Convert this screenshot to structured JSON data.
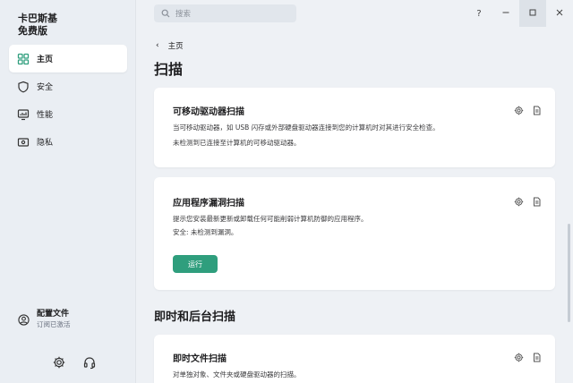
{
  "app": {
    "name_line1": "卡巴斯基",
    "name_line2": "免费版"
  },
  "sidebar": {
    "items": [
      {
        "label": "主页",
        "icon": "home-icon",
        "active": true
      },
      {
        "label": "安全",
        "icon": "shield-icon",
        "active": false
      },
      {
        "label": "性能",
        "icon": "performance-icon",
        "active": false
      },
      {
        "label": "隐私",
        "icon": "privacy-icon",
        "active": false
      }
    ],
    "profile": {
      "title": "配置文件",
      "subtitle": "订阅已激活",
      "icon": "user-icon"
    },
    "bottom_icons": [
      "gear-icon",
      "headset-icon"
    ]
  },
  "header": {
    "search_placeholder": "搜索",
    "help": "?",
    "controls": [
      "minimize-icon",
      "maximize-icon",
      "close-icon"
    ]
  },
  "breadcrumb": {
    "label": "主页"
  },
  "page_title": "扫描",
  "cards": [
    {
      "title": "可移动驱动器扫描",
      "lines": [
        "当可移动驱动器，如 USB 闪存或外部硬盘驱动器连接到您的计算机时对其进行安全检查。",
        "未检测到已连接至计算机的可移动驱动器。"
      ]
    },
    {
      "title": "应用程序漏洞扫描",
      "lines": [
        "提示您安装最新更新或卸载任何可能削弱计算机防御的应用程序。",
        "安全: 未检测到漏洞。"
      ],
      "button": "运行"
    },
    {
      "title": "即时文件扫描",
      "lines": [
        "对单独对象、文件夹或硬盘驱动器的扫描。"
      ]
    }
  ],
  "section_title": "即时和后台扫描",
  "colors": {
    "accent": "#2f9e7d",
    "sidebar_bg": "#eaeef3",
    "main_bg": "#eef1f5",
    "card_bg": "#ffffff"
  }
}
